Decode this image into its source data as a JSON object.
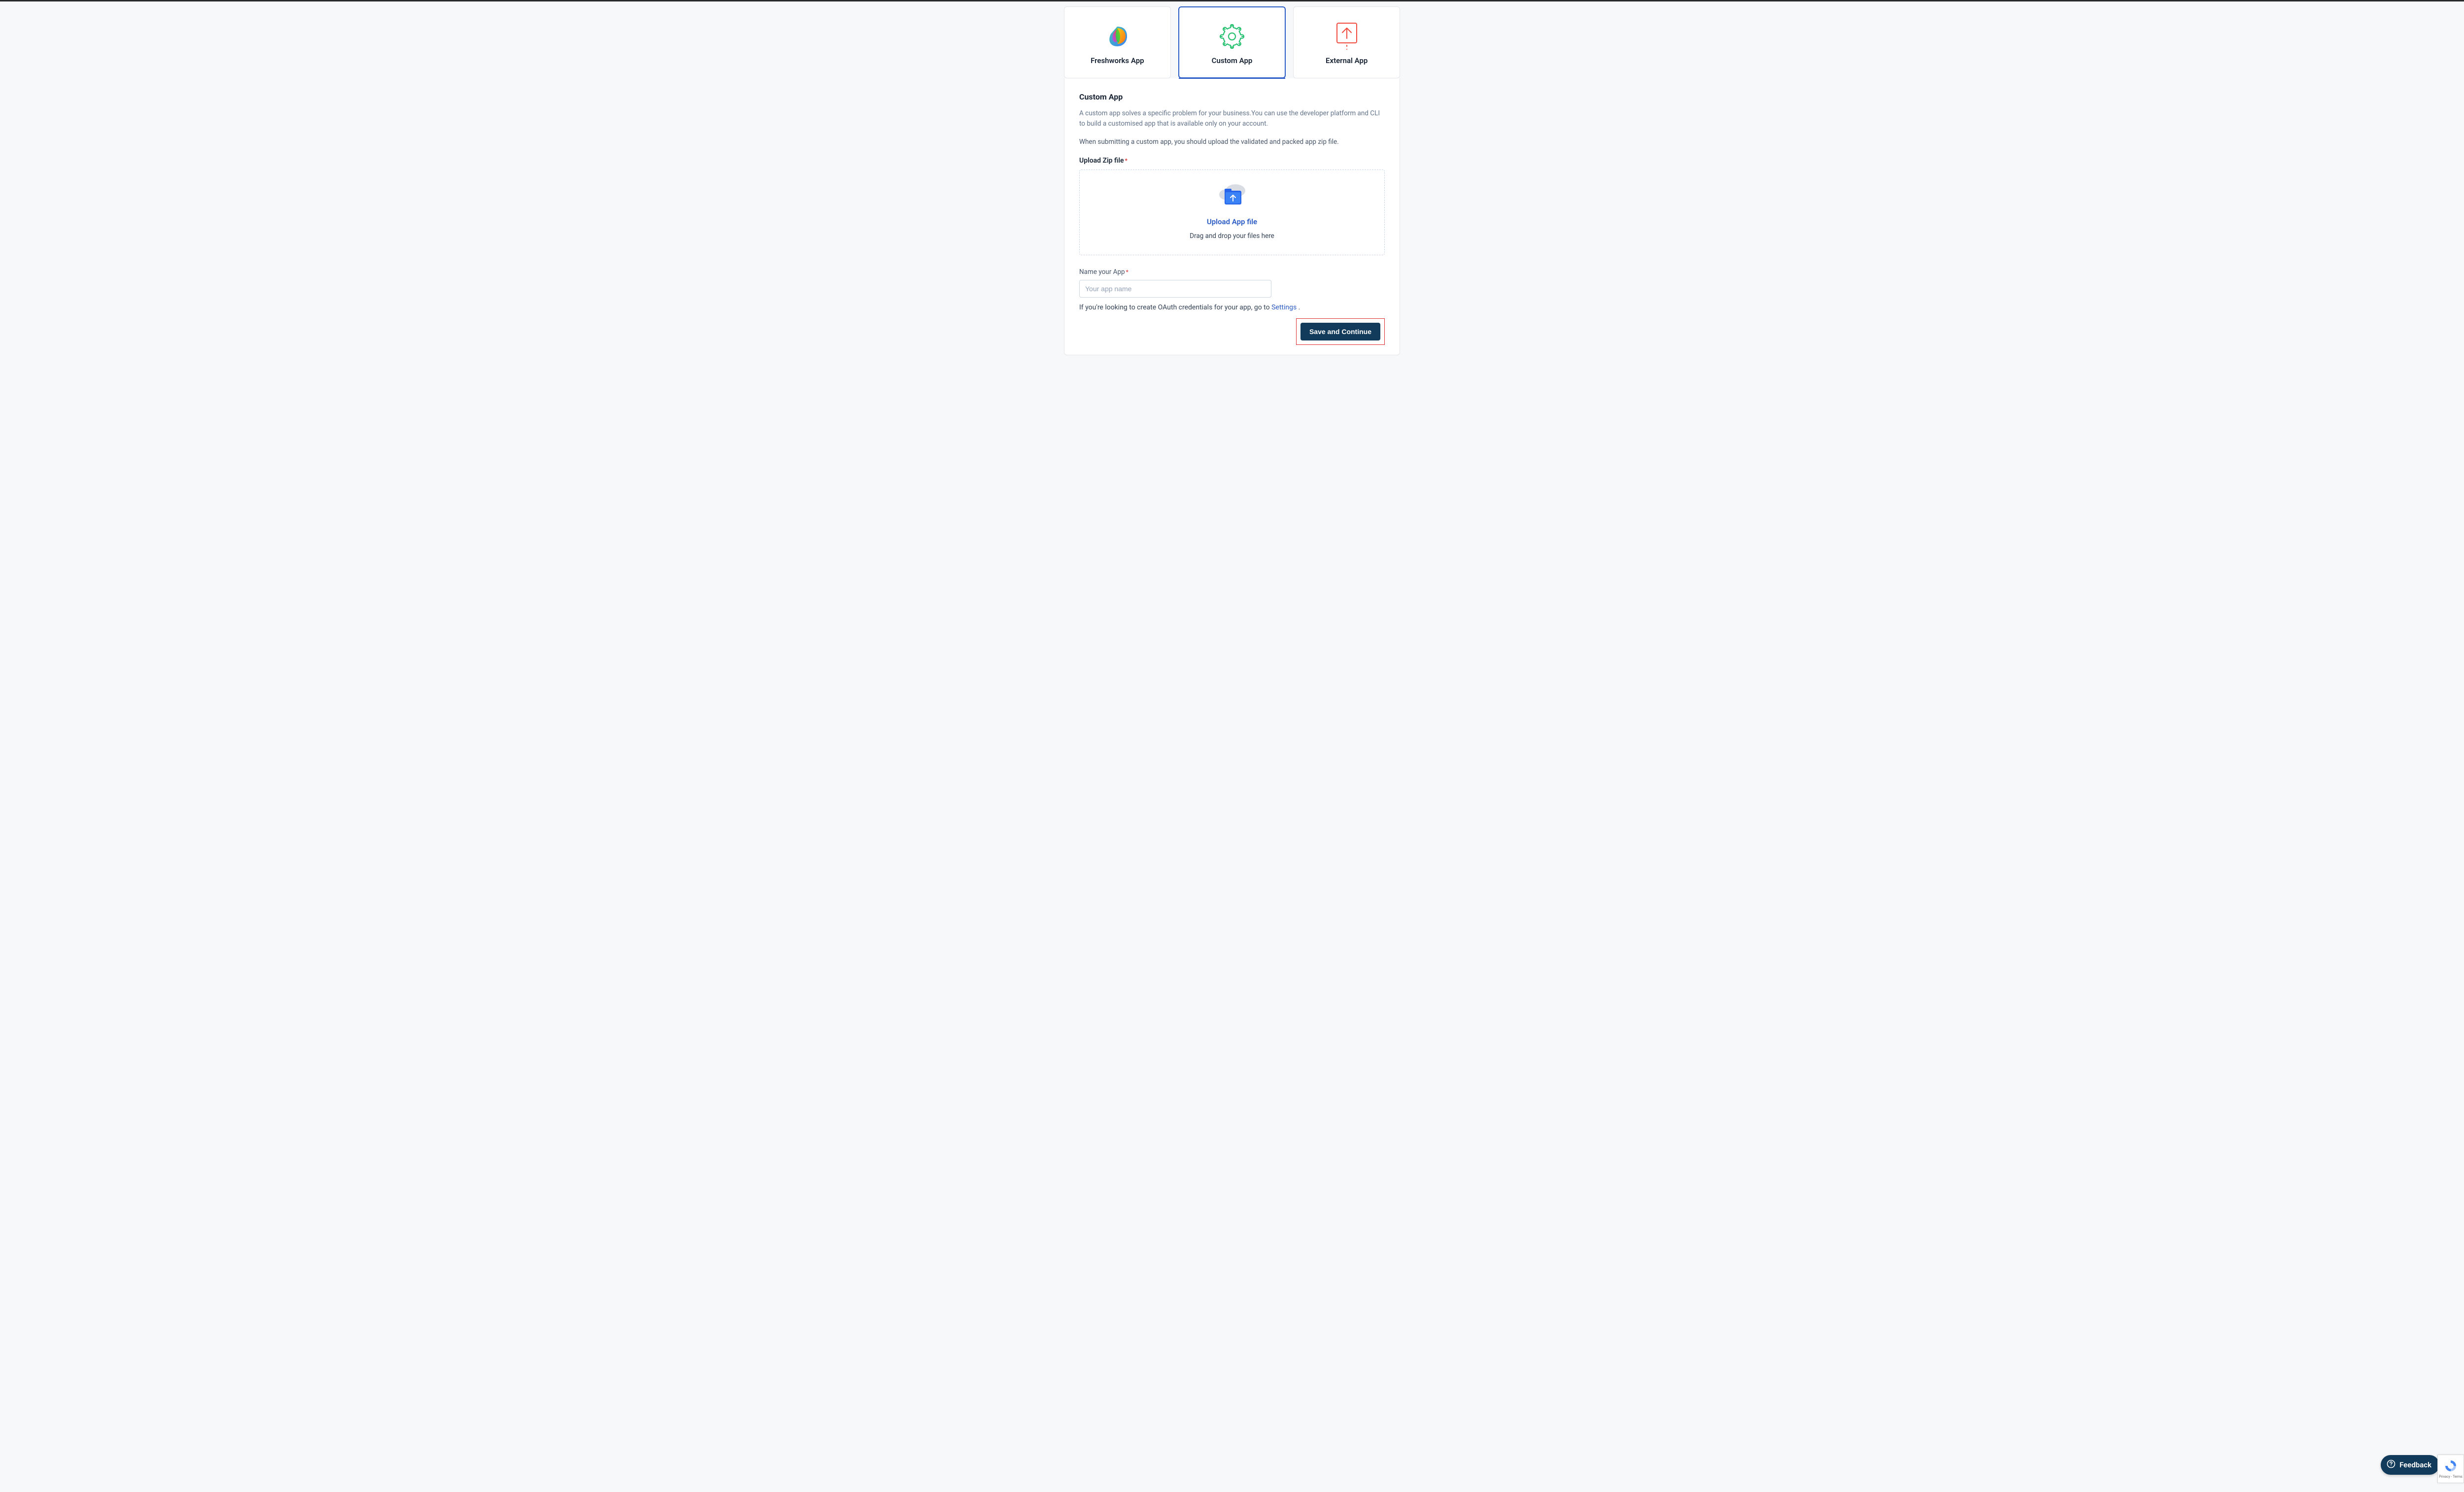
{
  "tabs": {
    "freshworks": {
      "label": "Freshworks App"
    },
    "custom": {
      "label": "Custom App"
    },
    "external": {
      "label": "External App"
    }
  },
  "panel": {
    "title": "Custom App",
    "desc1": "A custom app solves a specific problem for your business.You can use the developer platform and CLI to build a customised app that is available only on your account.",
    "desc2": "When submitting a custom app, you should upload the validated and packed app zip file.",
    "uploadLabel": "Upload Zip file",
    "dropzone": {
      "title": "Upload App file",
      "sub": "Drag and drop your files here"
    },
    "nameLabel": "Name your App",
    "namePlaceholder": "Your app name",
    "oauthPrefix": "If you're looking to create OAuth credentials for your app, go to ",
    "oauthLink": "Settings",
    "oauthSuffix": " .",
    "saveLabel": "Save and Continue"
  },
  "feedback": {
    "label": "Feedback"
  },
  "recaptcha": {
    "line1": "Privacy",
    "line2": "Terms"
  }
}
